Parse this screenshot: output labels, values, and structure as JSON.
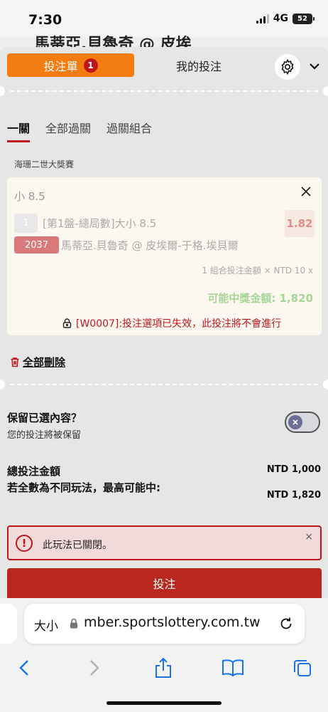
{
  "status": {
    "time": "7:30",
    "network": "4G",
    "battery": "52"
  },
  "behind_title": "馬蒂亞.貝魯奇 @ 皮埃",
  "header": {
    "tab_bet": "投注單",
    "tab_bet_badge": "1",
    "tab_mine": "我的投注"
  },
  "subtabs": [
    "一關",
    "全部過關",
    "過關組合"
  ],
  "tournament": "海珊二世大獎賽",
  "selection": {
    "title": "小 8.5",
    "leg_number": "1",
    "market": "[第1盤-總局數]大小 8.5",
    "odds": "1.82",
    "match_code": "2037",
    "match": "馬蒂亞.貝魯奇 @ 皮埃爾-于格.埃貝爾",
    "combo_line": "1 組合投注金額 × NTD 10 x",
    "payout": "可能中獎金額: 1,820",
    "error": "[W0007]:投注選項已失效，此投注將不會進行"
  },
  "delete_all": "全部刪除",
  "keep": {
    "title": "保留已選內容？",
    "subtitle": "您的投注將被保留"
  },
  "summary": {
    "total_label": "總投注金額",
    "total_value": "NTD 1,000",
    "maxwin_label": "若全數為不同玩法，最高可能中:",
    "maxwin_value": "NTD 1,820"
  },
  "alert": {
    "text": "此玩法已關閉。",
    "close": "×"
  },
  "bet_button": "投注",
  "browser": {
    "text_size": "大小",
    "url": "mber.sportslottery.com.tw"
  },
  "colors": {
    "accent_orange": "#f57c10",
    "brand_red": "#c0171d",
    "bet_button": "#b8281e"
  }
}
